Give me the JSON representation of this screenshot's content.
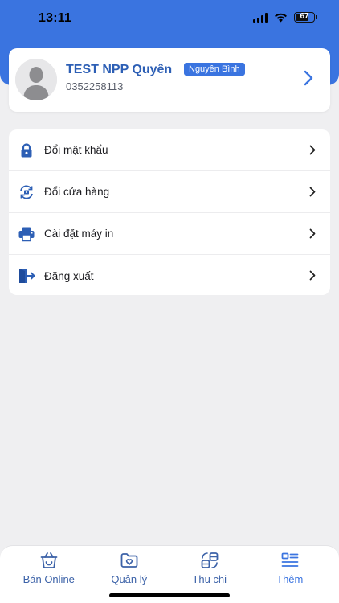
{
  "status_bar": {
    "time": "13:11",
    "battery": "67"
  },
  "profile": {
    "name": "TEST NPP Quyên",
    "badge": "Nguyên Bình",
    "phone": "0352258113"
  },
  "menu": {
    "items": [
      {
        "label": "Đổi mật khẩu",
        "icon": "lock-icon"
      },
      {
        "label": "Đổi cửa hàng",
        "icon": "store-swap-icon"
      },
      {
        "label": "Cài đặt máy in",
        "icon": "printer-icon"
      },
      {
        "label": "Đăng xuất",
        "icon": "logout-icon"
      }
    ]
  },
  "tabbar": {
    "tabs": [
      {
        "label": "Bán Online",
        "icon": "basket-icon"
      },
      {
        "label": "Quản lý",
        "icon": "folder-heart-icon"
      },
      {
        "label": "Thu chi",
        "icon": "exchange-icon"
      },
      {
        "label": "Thêm",
        "icon": "menu-list-icon"
      }
    ],
    "active_index": 3
  },
  "colors": {
    "primary": "#3a74e0",
    "name_text": "#2d5fb5",
    "background": "#efeff1"
  }
}
